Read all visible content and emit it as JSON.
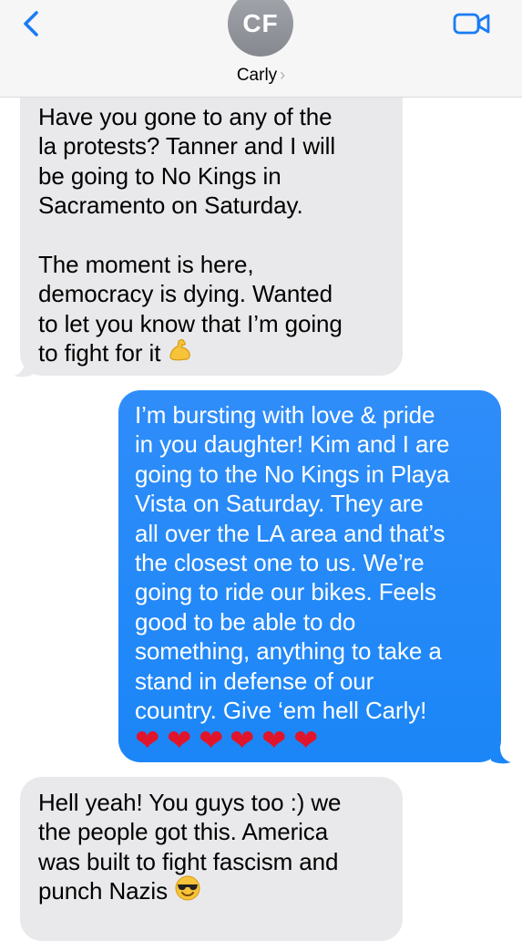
{
  "header": {
    "avatar_initials": "CF",
    "contact_name": "Carly",
    "contact_chevron": "›",
    "back_icon": "chevron-left-icon",
    "video_icon": "video-camera-icon",
    "accent_color": "#1a7cf6"
  },
  "messages": [
    {
      "direction": "received",
      "text": "Have you gone to any of the\nla protests? Tanner and I will\nbe going to No Kings in\nSacramento on Saturday.\n\nThe moment is here,\ndemocracy is dying. Wanted\nto let you know that I’m going\nto fight for it",
      "emoji": "flexed-biceps-emoji"
    },
    {
      "direction": "sent",
      "text": "I’m bursting with love & pride\nin you daughter! Kim and I are\ngoing to the No Kings in Playa\nVista on Saturday. They are\nall over the LA area and that’s\nthe closest one to us. We’re\ngoing to ride our bikes. Feels\ngood to be able to do\nsomething, anything to take a\nstand in defense of our\ncountry. Give ‘em hell Carly!",
      "hearts": "❤❤❤❤❤❤"
    },
    {
      "direction": "received",
      "text": "Hell yeah! You guys too :) we\nthe people got this. America\nwas built to fight fascism and\npunch Nazis",
      "emoji": "smiling-face-with-sunglasses-emoji"
    }
  ],
  "colors": {
    "received_bubble": "#e9e9eb",
    "sent_bubble": "#1a8cff"
  }
}
